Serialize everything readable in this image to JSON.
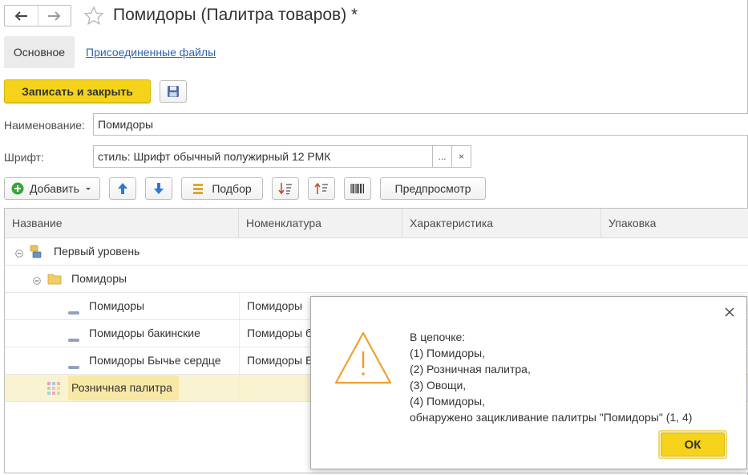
{
  "window": {
    "title": "Помидоры (Палитра товаров) *"
  },
  "tabs": [
    {
      "label": "Основное",
      "active": true
    },
    {
      "label": "Присоединенные файлы",
      "active": false
    }
  ],
  "commandbar": {
    "save_close_label": "Записать и закрыть",
    "save_icon": "floppy-disk-icon"
  },
  "fields": {
    "name": {
      "label": "Наименование:",
      "value": "Помидоры"
    },
    "font": {
      "label": "Шрифт:",
      "value": "стиль: Шрифт обычный полужирный 12 РМК",
      "choose_label": "...",
      "clear_label": "×"
    }
  },
  "toolbar": {
    "add_label": "Добавить",
    "pick_label": "Подбор",
    "preview_label": "Предпросмотр"
  },
  "table": {
    "columns": [
      "Название",
      "Номенклатура",
      "Характеристика",
      "Упаковка"
    ],
    "rows": [
      {
        "name": "Первый уровень",
        "nomenclature": "",
        "icon": "group-level-icon"
      },
      {
        "name": "Помидоры",
        "nomenclature": "",
        "icon": "folder-icon"
      },
      {
        "name": "Помидоры",
        "nomenclature": "Помидоры",
        "icon": "item-dash-icon"
      },
      {
        "name": "Помидоры бакинские",
        "nomenclature": "Помидоры б",
        "icon": "item-dash-icon"
      },
      {
        "name": "Помидоры Бычье сердце",
        "nomenclature": "Помидоры Б",
        "icon": "item-dash-icon"
      },
      {
        "name": "Розничная палитра",
        "nomenclature": "",
        "icon": "palette-grid-icon",
        "selected": true
      }
    ]
  },
  "dialog": {
    "lines": [
      "В цепочке:",
      "(1) Помидоры,",
      "(2) Розничная палитра,",
      "(3) Овощи,",
      "(4) Помидоры,",
      "обнаружено зацикливание палитры \"Помидоры\" (1, 4)"
    ],
    "ok_label": "ОК",
    "icon": "warning-triangle-icon"
  },
  "colors": {
    "accent_button": "#f5d31a",
    "link": "#2b63b4",
    "selected_row": "#faf3d2",
    "warning": "#f0a030"
  }
}
